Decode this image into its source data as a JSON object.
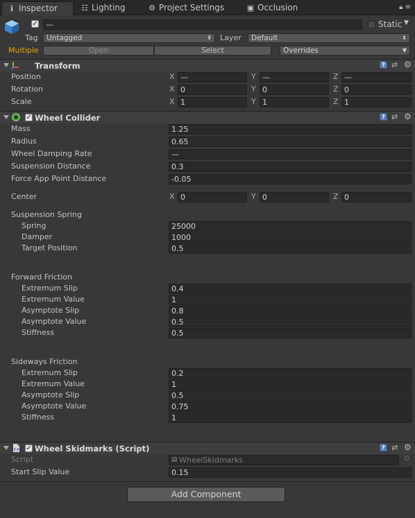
{
  "tabs": [
    {
      "label": "Inspector",
      "icon": "info-icon",
      "glyph": "ℹ"
    },
    {
      "label": "Lighting",
      "icon": "lighting-icon",
      "glyph": "☷"
    },
    {
      "label": "Project Settings",
      "icon": "gear-icon",
      "glyph": "⚙"
    },
    {
      "label": "Occlusion",
      "icon": "occlusion-icon",
      "glyph": "▣"
    }
  ],
  "header": {
    "name_value": "—",
    "static_label": "Static",
    "tag_label": "Tag",
    "tag_value": "Untagged",
    "layer_label": "Layer",
    "layer_value": "Default",
    "multiple_label": "Multiple",
    "open_label": "Open",
    "select_label": "Select",
    "overrides_label": "Overrides"
  },
  "transform": {
    "title": "Transform",
    "rows": [
      {
        "label": "Position",
        "x": "—",
        "y": "—",
        "z": "—"
      },
      {
        "label": "Rotation",
        "x": "0",
        "y": "0",
        "z": "0"
      },
      {
        "label": "Scale",
        "x": "1",
        "y": "1",
        "z": "1"
      }
    ]
  },
  "axes": {
    "x": "X",
    "y": "Y",
    "z": "Z"
  },
  "wheel_collider": {
    "title": "Wheel Collider",
    "mass_label": "Mass",
    "mass": "1.25",
    "radius_label": "Radius",
    "radius": "0.65",
    "damping_label": "Wheel Damping Rate",
    "damping": "—",
    "suspension_distance_label": "Suspension Distance",
    "suspension_distance": "0.3",
    "force_app_label": "Force App Point Distance",
    "force_app": "-0.05",
    "center_label": "Center",
    "center_x": "0",
    "center_y": "0",
    "center_z": "0",
    "spring_section": "Suspension Spring",
    "spring_label": "Spring",
    "spring": "25000",
    "damper_label": "Damper",
    "damper": "1000",
    "target_label": "Target Position",
    "target": "0.5",
    "forward_section": "Forward Friction",
    "forward": [
      {
        "label": "Extremum Slip",
        "value": "0.4"
      },
      {
        "label": "Extremum Value",
        "value": "1"
      },
      {
        "label": "Asymptote Slip",
        "value": "0.8"
      },
      {
        "label": "Asymptote Value",
        "value": "0.5"
      },
      {
        "label": "Stiffness",
        "value": "0.5"
      }
    ],
    "sideways_section": "Sideways Friction",
    "sideways": [
      {
        "label": "Extremum Slip",
        "value": "0.2"
      },
      {
        "label": "Extremum Value",
        "value": "1"
      },
      {
        "label": "Asymptote Slip",
        "value": "0.5"
      },
      {
        "label": "Asymptote Value",
        "value": "0.75"
      },
      {
        "label": "Stiffness",
        "value": "1"
      }
    ]
  },
  "skidmarks": {
    "title": "Wheel Skidmarks (Script)",
    "script_label": "Script",
    "script_value": "WheelSkidmarks",
    "start_slip_label": "Start Slip Value",
    "start_slip": "0.15"
  },
  "add_component_label": "Add Component",
  "colors": {
    "accent_multiple": "#e8a800",
    "panel": "#383838"
  }
}
